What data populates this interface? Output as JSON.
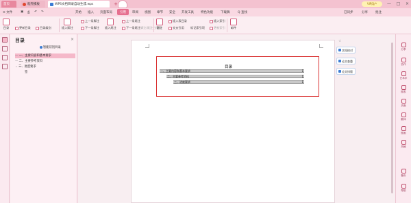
{
  "titlebar": {
    "tabs": [
      {
        "label": "首页"
      },
      {
        "label": "稻壳模板"
      },
      {
        "label": "WPS文档目录自动生成.wps"
      }
    ],
    "user_label": "VIP用户",
    "window_controls": [
      "—",
      "□",
      "×"
    ]
  },
  "menu": {
    "file_label": "≡ 文件",
    "items": [
      "开始",
      "插入",
      "页面布局",
      "引用",
      "审阅",
      "视图",
      "章节",
      "安全",
      "开发工具",
      "特色功能",
      "下载稿",
      "Q 查找"
    ],
    "active_index": 3,
    "right": [
      "已同步",
      "分享",
      "批注"
    ]
  },
  "ribbon": {
    "toc_label": "目录",
    "update_toc_label": "更新目录",
    "toc_level_label": "目录级别",
    "insert_footnote_label": "插入脚注",
    "prev_footnote_label": "上一条脚注",
    "next_footnote_label": "下一条脚注",
    "insert_endnote_label": "插入尾注",
    "prev_endnote_label": "上一条尾注",
    "next_endnote_label": "下一条尾注",
    "footnote_settings_label": "脚注/尾注分隔线",
    "caption_label": "题注",
    "insert_toc_table_label": "插入表目录",
    "crossref_label": "交叉引用",
    "mark_index_label": "标记索引项",
    "insert_index_label": "插入索引",
    "update_index_label": "更新索引",
    "mail_label": "邮件"
  },
  "navpane": {
    "title": "目录",
    "close": "×",
    "smart_toc_label": "智能识别目录",
    "items": [
      {
        "label": "一、主要内容和基本要求",
        "selected": true
      },
      {
        "label": "二、主要参考资料",
        "selected": false
      },
      {
        "label": "三、进度要求",
        "selected": false
      },
      {
        "label": "签",
        "selected": false
      }
    ]
  },
  "document": {
    "toc_title": "目录",
    "toc_entries": [
      {
        "text": "一、主要内容和基本要求",
        "page": "1"
      },
      {
        "text": "二、主要参考资料",
        "page": "1"
      },
      {
        "text": "三、进度要求",
        "page": "1"
      }
    ]
  },
  "floating_panel": {
    "buttons": [
      "文档校对",
      "论文查重",
      "论文排版"
    ]
  },
  "rightbar": {
    "items": [
      "分享",
      "协作",
      "艺术字",
      "图表",
      "页面",
      "翻译",
      "图画",
      "风格",
      "备份",
      "帮助"
    ]
  },
  "colors": {
    "accent": "#e66f8f",
    "highlight_border": "#d92d2d",
    "background": "#f7e4ea"
  }
}
